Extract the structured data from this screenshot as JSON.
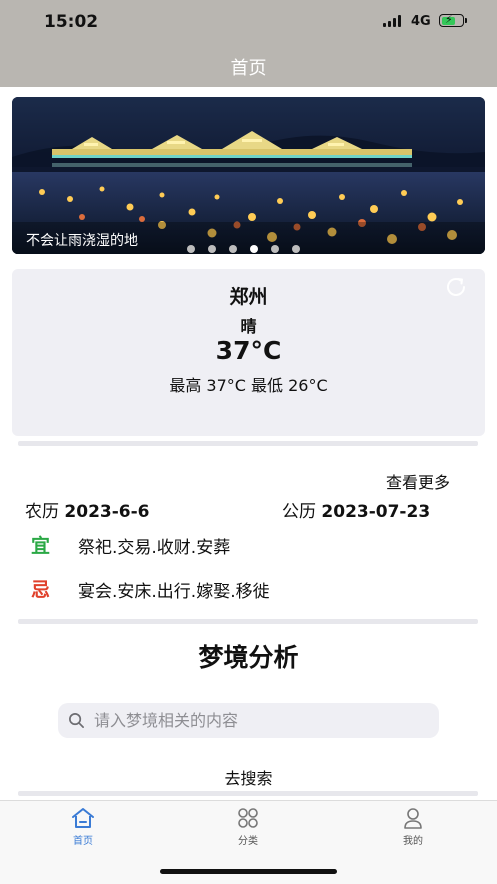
{
  "status_bar": {
    "time": "15:02",
    "network": "4G",
    "battery_level": 0.7,
    "icons": [
      "signal-icon",
      "battery-charging-icon"
    ]
  },
  "nav": {
    "title": "首页"
  },
  "banner": {
    "caption": "不会让雨浇湿的地",
    "page_count": 6,
    "active_index": 3
  },
  "weather": {
    "city": "郑州",
    "condition": "晴",
    "temperature": "37°C",
    "range": "最高 37°C  最低 26°C",
    "refresh_icon": "refresh-icon"
  },
  "almanac": {
    "more_link": "查看更多",
    "lunar_label": "农历",
    "lunar_date": "2023-6-6",
    "solar_label": "公历",
    "solar_date": "2023-07-23",
    "yi_label": "宜",
    "yi_items": "祭祀.交易.收财.安葬",
    "ji_label": "忌",
    "ji_items": "宴会.安床.出行.嫁娶.移徙",
    "colors": {
      "yi": "#2aa845",
      "ji": "#e0412c"
    }
  },
  "dream": {
    "title": "梦境分析",
    "search_placeholder": "请入梦境相关的内容",
    "search_value": "",
    "search_button": "去搜索"
  },
  "tab_bar": {
    "items": [
      {
        "label": "首页",
        "icon": "home-icon",
        "active": true
      },
      {
        "label": "分类",
        "icon": "grid-icon",
        "active": false
      },
      {
        "label": "我的",
        "icon": "person-icon",
        "active": false
      }
    ],
    "active_color": "#3a7bd5"
  }
}
